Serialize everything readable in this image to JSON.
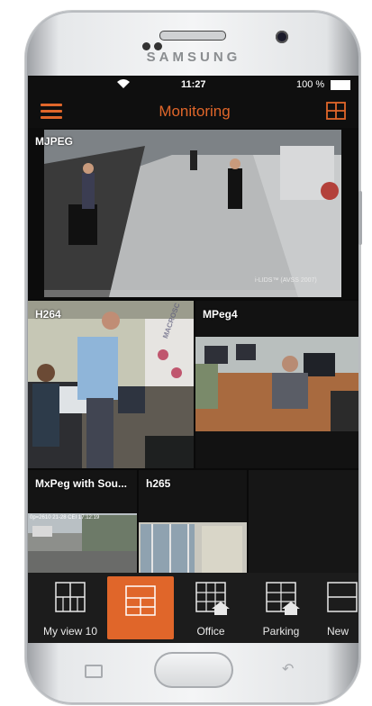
{
  "device": {
    "brand": "SAMSUNG"
  },
  "status_bar": {
    "time": "11:27",
    "battery": "100 %"
  },
  "app_bar": {
    "title": "Monitoring"
  },
  "cameras": [
    {
      "label": "MJPEG",
      "overlay_text": "i-LIDS™ (AVSS 2007)"
    },
    {
      "label": "H264",
      "overlay_text": "MACROSC"
    },
    {
      "label": "MPeg4"
    },
    {
      "label": "MxPeg with Sou...",
      "overlay_text": "0p=2610 21-28 CEI 17:12:19"
    },
    {
      "label": "h265"
    }
  ],
  "views": [
    {
      "label": "My view 10"
    },
    {
      "label": ""
    },
    {
      "label": "Office"
    },
    {
      "label": "Parking"
    },
    {
      "label": "New"
    }
  ],
  "colors": {
    "accent": "#e0662a",
    "background": "#0f0f0f",
    "bar": "#1c1c1c"
  }
}
